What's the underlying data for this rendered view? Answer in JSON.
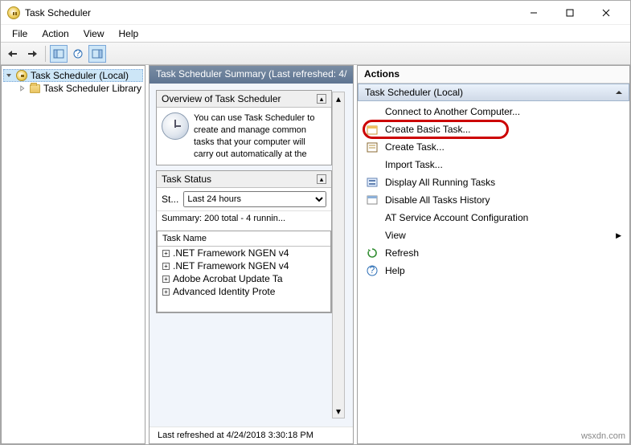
{
  "window": {
    "title": "Task Scheduler",
    "minimize": "Minimize",
    "maximize": "Maximize",
    "close": "Close"
  },
  "menu": {
    "file": "File",
    "action": "Action",
    "view": "View",
    "help": "Help"
  },
  "tree": {
    "root": "Task Scheduler (Local)",
    "library": "Task Scheduler Library"
  },
  "mid": {
    "header": "Task Scheduler Summary (Last refreshed: 4/",
    "overview_title": "Overview of Task Scheduler",
    "overview_text": "You can use Task Scheduler to create and manage common tasks that your computer will carry out automatically at the",
    "status_title": "Task Status",
    "status_label": "St...",
    "status_select": "Last 24 hours",
    "summary": "Summary: 200 total - 4 runnin...",
    "col_taskname": "Task Name",
    "tasks": [
      ".NET Framework NGEN v4",
      ".NET Framework NGEN v4",
      "Adobe Acrobat Update Ta",
      "Advanced Identity Prote"
    ],
    "last_refreshed": "Last refreshed at 4/24/2018 3:30:18 PM"
  },
  "actions": {
    "title": "Actions",
    "sub": "Task Scheduler (Local)",
    "items": {
      "connect": "Connect to Another Computer...",
      "create_basic": "Create Basic Task...",
      "create_task": "Create Task...",
      "import": "Import Task...",
      "display_running": "Display All Running Tasks",
      "disable_history": "Disable All Tasks History",
      "at_service": "AT Service Account Configuration",
      "view": "View",
      "refresh": "Refresh",
      "help": "Help"
    }
  },
  "watermark": "wsxdn.com"
}
